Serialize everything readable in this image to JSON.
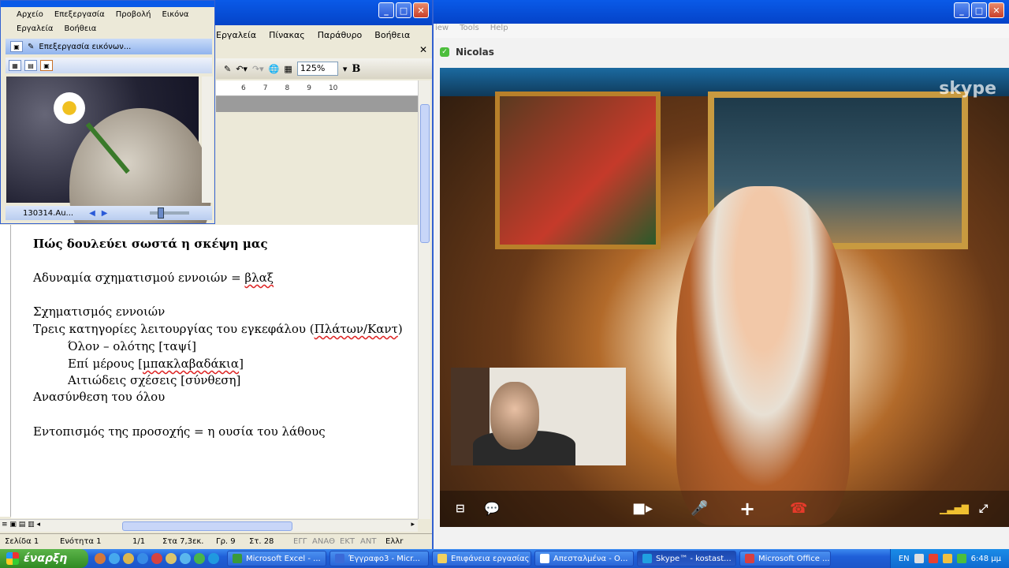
{
  "word": {
    "menu": [
      "Εργαλεία",
      "Πίνακας",
      "Παράθυρο",
      "Βοήθεια"
    ],
    "zoom": "125%",
    "bold_label": "B",
    "ruler_ticks": [
      "6",
      "7",
      "8",
      "9",
      "10"
    ],
    "doc": {
      "heading": "Πώς δουλεύει σωστά η σκέψη μας",
      "line1_a": "Αδυναμία σχηματισμού εννοιών = ",
      "line1_b": "βλαξ",
      "line2": "Σχηματισμός εννοιών",
      "line3_a": "Τρεις κατηγορίες λειτουργίας του εγκεφάλου (",
      "line3_b": "Πλάτων/Καντ",
      "line3_c": ")",
      "line4": "Όλον – ολότης [ταψί]",
      "line5_a": "Επί μέρους [",
      "line5_b": "μπακλαβαδάκια",
      "line5_c": "]",
      "line6": "Αιτιώδεις σχέσεις [σύνθεση]",
      "line7": "Ανασύνθεση του όλου",
      "line8": "Εντοπισμός της προσοχής = η ουσία του λάθους"
    },
    "status": {
      "page": "Σελίδα 1",
      "section": "Ενότητα 1",
      "pages": "1/1",
      "at": "Στα 7,3εκ.",
      "line": "Γρ. 9",
      "col": "Στ. 28",
      "rec": "ΕΓΓ",
      "trk": "ΑΝΑΘ",
      "ext": "ΕΚΤ",
      "ovr": "ΑΝΤ",
      "lang": "Ελλr"
    }
  },
  "viewer": {
    "menu_row1": [
      "Αρχείο",
      "Επεξεργασία",
      "Προβολή",
      "Εικόνα"
    ],
    "menu_row2": [
      "Εργαλεία",
      "Βοήθεια"
    ],
    "edit_button": "Επεξεργασία εικόνων...",
    "filename": "130314.Au..."
  },
  "skype": {
    "menu": [
      "iew",
      "Tools",
      "Help"
    ],
    "contact_name": "Nicolas",
    "logo": "skype"
  },
  "taskbar": {
    "start_label": "έναρξη",
    "tasks": [
      "Microsoft Excel - ...",
      "Έγγραφο3 - Micr...",
      "Επιφάνεια εργασίας",
      "Απεσταλμένα - Ο...",
      "Skype™ - kostast...",
      "Microsoft Office ..."
    ],
    "lang": "EN",
    "clock": "6:48 μμ"
  }
}
